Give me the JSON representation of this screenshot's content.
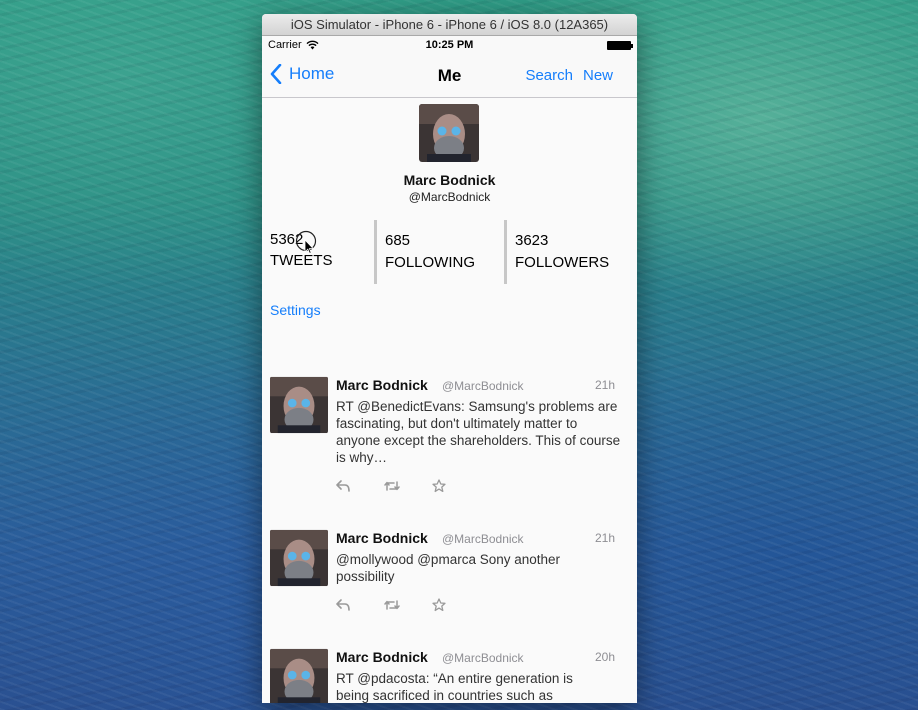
{
  "window": {
    "title": "iOS Simulator - iPhone 6 - iPhone 6 / iOS 8.0 (12A365)"
  },
  "statusbar": {
    "carrier": "Carrier",
    "time": "10:25 PM"
  },
  "navbar": {
    "back_label": "Home",
    "title": "Me",
    "search_label": "Search",
    "new_label": "New"
  },
  "profile": {
    "name": "Marc Bodnick",
    "handle": "@MarcBodnick",
    "stats": [
      {
        "value": "5362",
        "label": "TWEETS"
      },
      {
        "value": "685",
        "label": "FOLLOWING"
      },
      {
        "value": "3623",
        "label": "FOLLOWERS"
      }
    ],
    "settings_label": "Settings"
  },
  "tweets": [
    {
      "name": "Marc Bodnick",
      "handle": "@MarcBodnick",
      "time": "21h",
      "text": "RT @BenedictEvans: Samsung's problems are fascinating, but don't ultimately matter to anyone except the shareholders. This of course is why…"
    },
    {
      "name": "Marc Bodnick",
      "handle": "@MarcBodnick",
      "time": "21h",
      "text": "@mollywood @pmarca Sony another possibility"
    },
    {
      "name": "Marc Bodnick",
      "handle": "@MarcBodnick",
      "time": "20h",
      "text": "RT @pdacosta: “An entire generation is being sacrificed in countries such as"
    }
  ],
  "icons": {
    "reply": "reply-icon",
    "retweet": "retweet-icon",
    "favorite": "star-icon"
  },
  "colors": {
    "accent": "#157efb",
    "secondary_text": "#8e8e93"
  }
}
